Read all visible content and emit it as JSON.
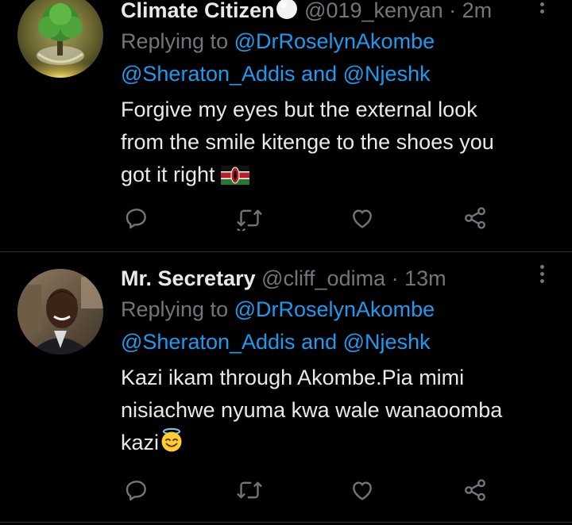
{
  "tweets": [
    {
      "name": "Climate Citizen",
      "handle": "@019_kenyan",
      "separator": "·",
      "time": "2m",
      "replying_prefix": "Replying to",
      "mention_1": "@DrRoselynAkombe",
      "mention_2": "@Sheraton_Addis",
      "mention_joiner": "and",
      "mention_3": "@Njeshk",
      "text_line_1": "Forgive my eyes but the external look",
      "text_line_2": "from the smile kitenge to the shoes you",
      "text_line_3": "got it right",
      "name_emoji": "white-circle-icon",
      "body_emoji": "kenya-flag-icon"
    },
    {
      "name": "Mr. Secretary",
      "handle": "@cliff_odima",
      "separator": "·",
      "time": "13m",
      "replying_prefix": "Replying to",
      "mention_1": "@DrRoselynAkombe",
      "mention_2": "@Sheraton_Addis",
      "mention_joiner": "and",
      "mention_3": "@Njeshk",
      "text_line_1": "Kazi ikam through Akombe.Pia mimi",
      "text_line_2": "nisiachwe nyuma kwa wale wanaoomba",
      "text_line_3": "kazi",
      "body_emoji": "smiling-face-with-halo-icon"
    }
  ],
  "colors": {
    "background": "#000000",
    "primary_text": "#e7e9ea",
    "secondary_text": "#71767b",
    "accent": "#1d9bf0",
    "divider": "#2f3336"
  },
  "icons": [
    "reply-icon",
    "retweet-icon",
    "like-icon",
    "share-icon",
    "more-options-icon"
  ]
}
